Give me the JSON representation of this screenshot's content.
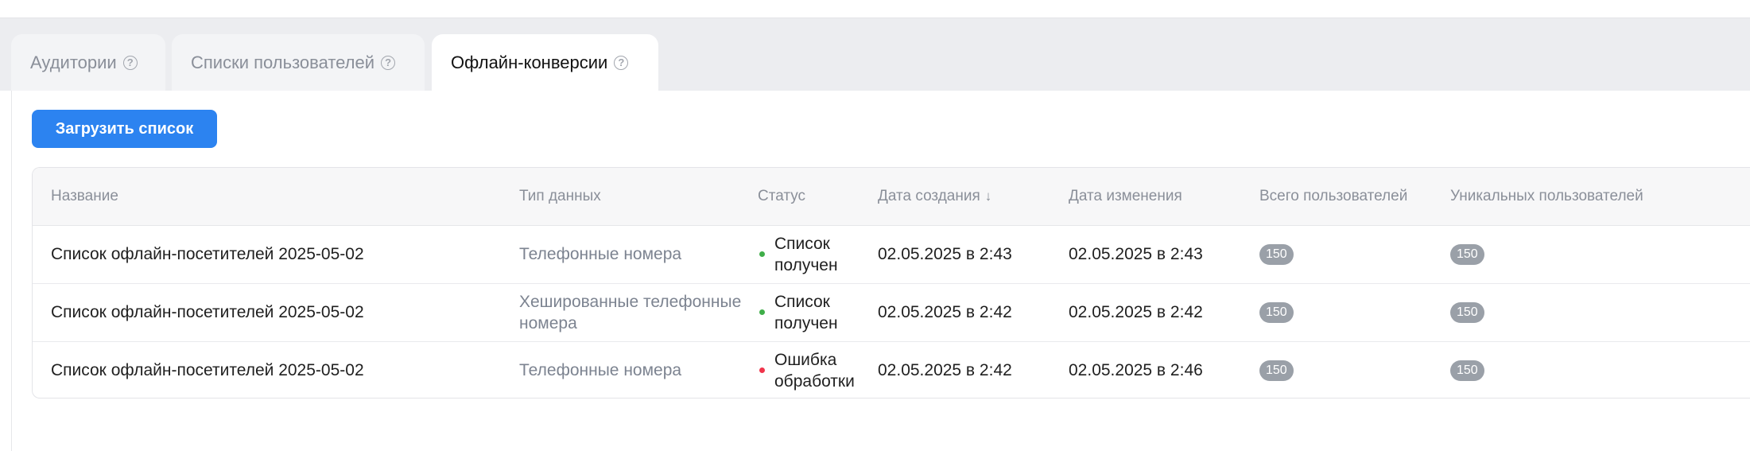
{
  "tabs": [
    {
      "label": "Аудитории",
      "active": false
    },
    {
      "label": "Списки пользователей",
      "active": false
    },
    {
      "label": "Офлайн-конверсии",
      "active": true
    }
  ],
  "upload_button": "Загрузить список",
  "table": {
    "headers": {
      "name": "Название",
      "type": "Тип данных",
      "status": "Статус",
      "created": "Дата создания",
      "modified": "Дата изменения",
      "total": "Всего пользователей",
      "unique": "Уникальных пользователей"
    },
    "sort_arrow": "↓",
    "rows": [
      {
        "name": "Список офлайн-посетителей 2025-05-02",
        "type": "Телефонные номера",
        "status_line1": "Список",
        "status_line2": "получен",
        "status_color": "#3fae49",
        "created": "02.05.2025 в 2:43",
        "modified": "02.05.2025 в 2:43",
        "total": "150",
        "unique": "150"
      },
      {
        "name": "Список офлайн-посетителей 2025-05-02",
        "type": "Хешированные телефонные номера",
        "status_line1": "Список",
        "status_line2": "получен",
        "status_color": "#3fae49",
        "created": "02.05.2025 в 2:42",
        "modified": "02.05.2025 в 2:42",
        "total": "150",
        "unique": "150"
      },
      {
        "name": "Список офлайн-посетителей 2025-05-02",
        "type": "Телефонные номера",
        "status_line1": "Ошибка",
        "status_line2": "обработки",
        "status_color": "#f0344b",
        "created": "02.05.2025 в 2:42",
        "modified": "02.05.2025 в 2:46",
        "total": "150",
        "unique": "150"
      }
    ]
  }
}
